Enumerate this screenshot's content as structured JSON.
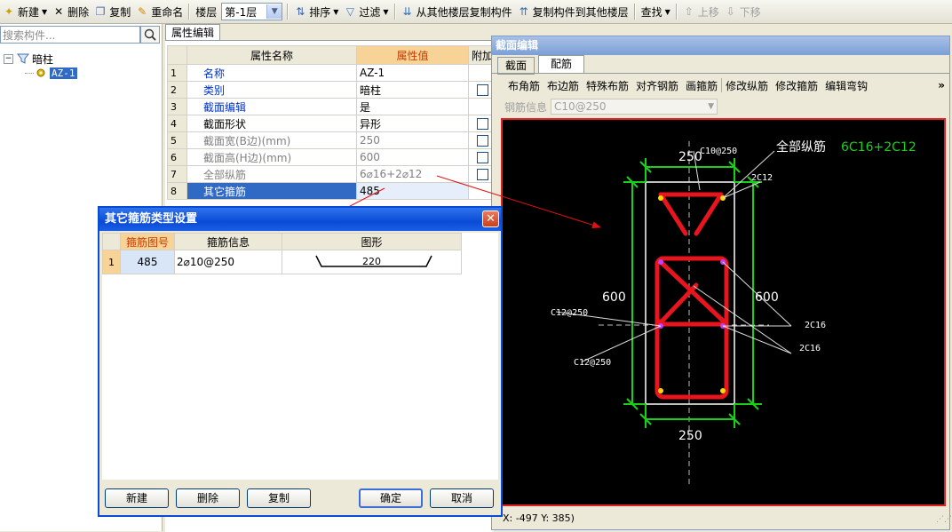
{
  "toolbar": {
    "new": "新建",
    "delete": "删除",
    "copy": "复制",
    "rename": "重命名",
    "floor_label": "楼层",
    "floor_value": "第-1层",
    "sort": "排序",
    "filter": "过滤",
    "copy_from_floor": "从其他楼层复制构件",
    "copy_to_floor": "复制构件到其他楼层",
    "find": "查找",
    "move_up": "上移",
    "move_down": "下移"
  },
  "left_panel": {
    "search_placeholder": "搜索构件...",
    "tree_root": "暗柱",
    "tree_child": "AZ-1"
  },
  "properties": {
    "tab": "属性编辑",
    "headers": {
      "name": "属性名称",
      "value": "属性值",
      "extra": "附加"
    },
    "rows": [
      {
        "num": "1",
        "name": "名称",
        "value": "AZ-1"
      },
      {
        "num": "2",
        "name": "类别",
        "value": "暗柱"
      },
      {
        "num": "3",
        "name": "截面编辑",
        "value": "是"
      },
      {
        "num": "4",
        "name": "截面形状",
        "value": "异形"
      },
      {
        "num": "5",
        "name": "截面宽(B边)(mm)",
        "value": "250"
      },
      {
        "num": "6",
        "name": "截面高(H边)(mm)",
        "value": "600"
      },
      {
        "num": "7",
        "name": "全部纵筋",
        "value": "6⌀16+2⌀12"
      },
      {
        "num": "8",
        "name": "其它箍筋",
        "value": "485"
      }
    ]
  },
  "section_editor": {
    "title": "截面编辑",
    "tabs": [
      "截面",
      "配筋"
    ],
    "tools": [
      "布角筋",
      "布边筋",
      "特殊布筋",
      "对齐钢筋",
      "画箍筋",
      "修改纵筋",
      "修改箍筋",
      "编辑弯钩"
    ],
    "more": "»",
    "rebar_label": "钢筋信息",
    "rebar_value": "C10@250",
    "status": "X: -497 Y: 385)",
    "drawing": {
      "stirrup_label": "C10@250",
      "all_long_label": "全部纵筋",
      "all_long_value": "6C16+2C12",
      "c12_label": "2C12",
      "c16_label_1": "2C16",
      "c16_label_2": "2C16",
      "left_stirrup_1": "C12@250",
      "left_stirrup_2": "C12@250",
      "dim_top": "250",
      "dim_bottom": "250",
      "dim_left": "600",
      "dim_right": "600"
    }
  },
  "dialog": {
    "title": "其它箍筋类型设置",
    "close": "✕",
    "headers": {
      "id": "箍筋图号",
      "info": "箍筋信息",
      "shape": "图形"
    },
    "row": {
      "num": "1",
      "id": "485",
      "info": "2⌀10@250",
      "shape_value": "220"
    },
    "buttons": {
      "new": "新建",
      "delete": "删除",
      "copy": "复制",
      "ok": "确定",
      "cancel": "取消"
    }
  }
}
